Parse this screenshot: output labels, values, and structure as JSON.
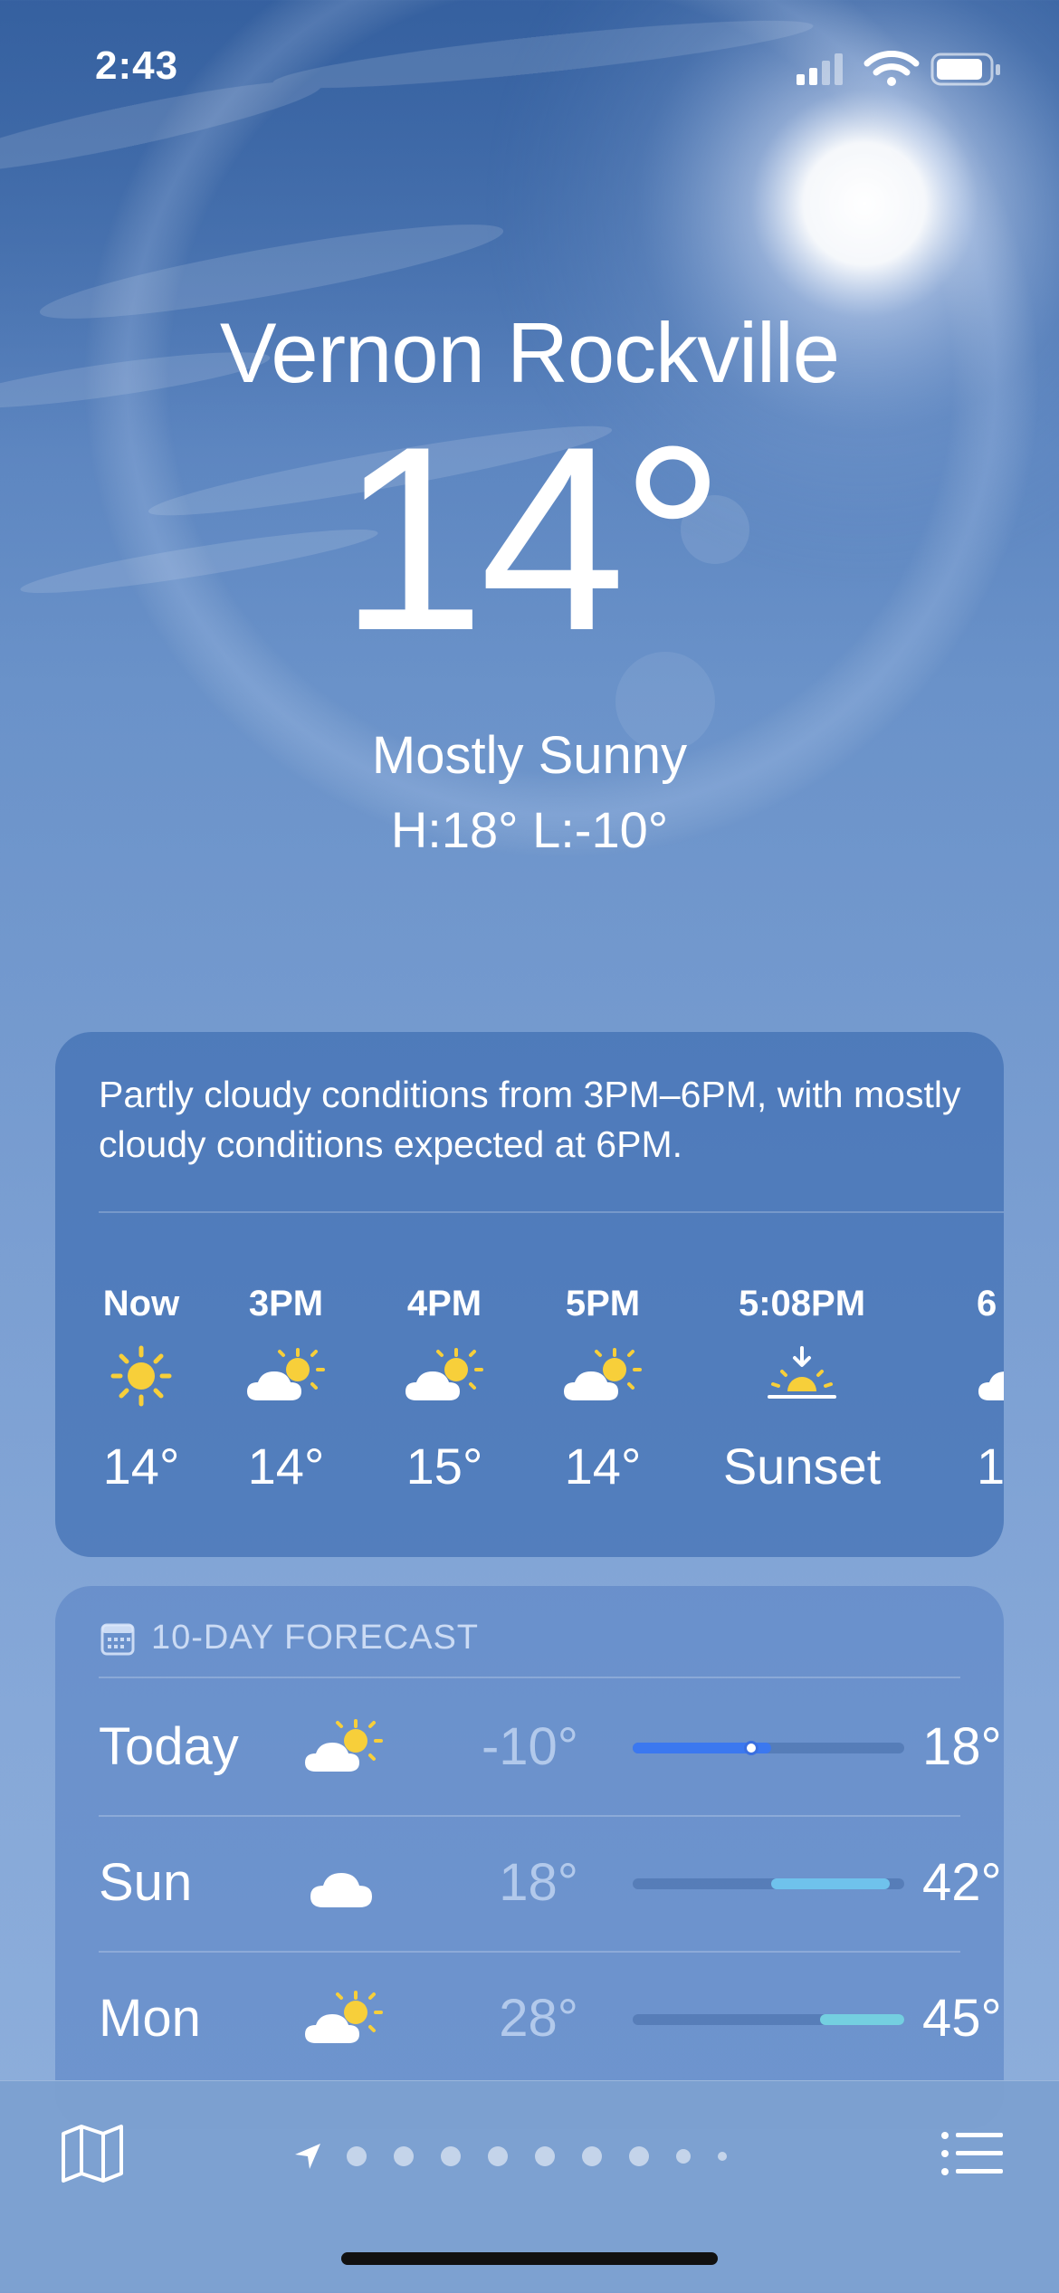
{
  "status_bar": {
    "time": "2:43"
  },
  "location": {
    "city": "Vernon Rockville",
    "temperature": "14°",
    "condition": "Mostly Sunny",
    "high_low": "H:18°  L:-10°"
  },
  "hourly": {
    "summary": "Partly cloudy conditions from 3PM–6PM, with mostly cloudy conditions expected at 6PM.",
    "hours": [
      {
        "label": "Now",
        "icon": "sun-icon",
        "value": "14°"
      },
      {
        "label": "3PM",
        "icon": "partly-cloudy-icon",
        "value": "14°"
      },
      {
        "label": "4PM",
        "icon": "partly-cloudy-icon",
        "value": "15°"
      },
      {
        "label": "5PM",
        "icon": "partly-cloudy-icon",
        "value": "14°"
      },
      {
        "label": "5:08PM",
        "icon": "sunset-icon",
        "value": "Sunset"
      },
      {
        "label": "6",
        "icon": "cloud-icon",
        "value": "1"
      }
    ]
  },
  "forecast": {
    "header": "10-DAY FORECAST",
    "range_min": -10,
    "range_max": 45,
    "days": [
      {
        "day": "Today",
        "icon": "partly-cloudy-icon",
        "low": "-10°",
        "high": "18°",
        "low_value": -10,
        "high_value": 18,
        "current_value": 14,
        "bar_color": "#3b78f0"
      },
      {
        "day": "Sun",
        "icon": "cloud-icon",
        "low": "18°",
        "high": "42°",
        "low_value": 18,
        "high_value": 42,
        "bar_color": "#6fc2ec"
      },
      {
        "day": "Mon",
        "icon": "partly-cloudy-icon",
        "low": "28°",
        "high": "45°",
        "low_value": 28,
        "high_value": 45,
        "bar_color": "#74cfe0"
      }
    ]
  },
  "toolbar": {
    "map_icon": "map-icon",
    "list_icon": "list-icon",
    "location_icon": "location-arrow-icon",
    "page_count": 9,
    "current_page": 0
  }
}
